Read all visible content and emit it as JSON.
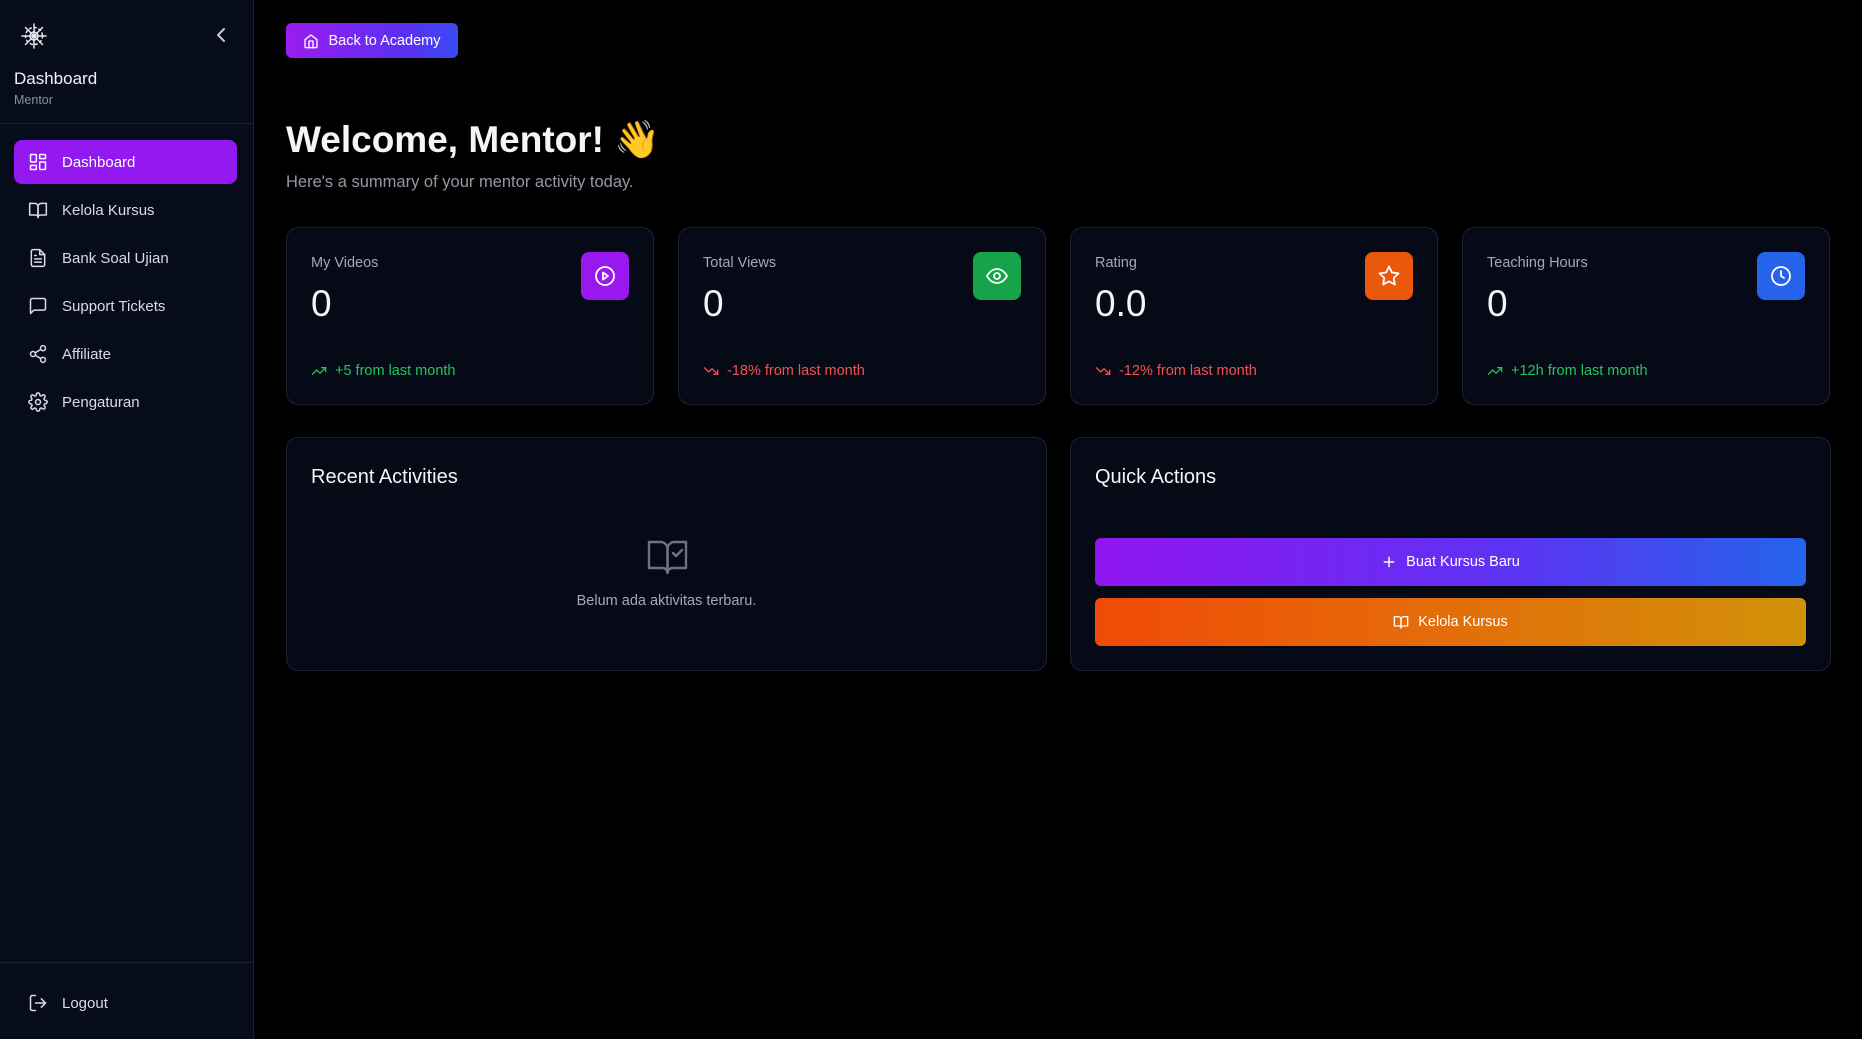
{
  "sidebar": {
    "title": "Dashboard",
    "subtitle": "Mentor",
    "items": [
      {
        "label": "Dashboard",
        "icon": "layout-dashboard-icon",
        "active": true
      },
      {
        "label": "Kelola Kursus",
        "icon": "book-open-icon",
        "active": false
      },
      {
        "label": "Bank Soal Ujian",
        "icon": "file-text-icon",
        "active": false
      },
      {
        "label": "Support Tickets",
        "icon": "message-square-icon",
        "active": false
      },
      {
        "label": "Affiliate",
        "icon": "share-icon",
        "active": false
      },
      {
        "label": "Pengaturan",
        "icon": "settings-icon",
        "active": false
      }
    ],
    "logout_label": "Logout"
  },
  "header": {
    "back_label": "Back to Academy"
  },
  "welcome": {
    "title": "Welcome, Mentor! 👋",
    "subtitle": "Here's a summary of your mentor activity today."
  },
  "stats": [
    {
      "label": "My Videos",
      "value": "0",
      "trend": "+5 from last month",
      "direction": "up",
      "icon": "play-circle-icon",
      "color": "#9a18f0"
    },
    {
      "label": "Total Views",
      "value": "0",
      "trend": "-18% from last month",
      "direction": "down",
      "icon": "eye-icon",
      "color": "#16a34a"
    },
    {
      "label": "Rating",
      "value": "0.0",
      "trend": "-12% from last month",
      "direction": "down",
      "icon": "star-icon",
      "color": "#ea580c"
    },
    {
      "label": "Teaching Hours",
      "value": "0",
      "trend": "+12h from last month",
      "direction": "up",
      "icon": "clock-icon",
      "color": "#2563eb"
    }
  ],
  "recent": {
    "title": "Recent Activities",
    "empty_text": "Belum ada aktivitas terbaru."
  },
  "quick_actions": {
    "title": "Quick Actions",
    "create_label": "Buat Kursus Baru",
    "manage_label": "Kelola Kursus"
  },
  "colors": {
    "accent": "#9418f0",
    "up": "#22c55e",
    "down": "#f05252",
    "card_bg": "#060a17",
    "sidebar_bg": "#070c1a"
  }
}
